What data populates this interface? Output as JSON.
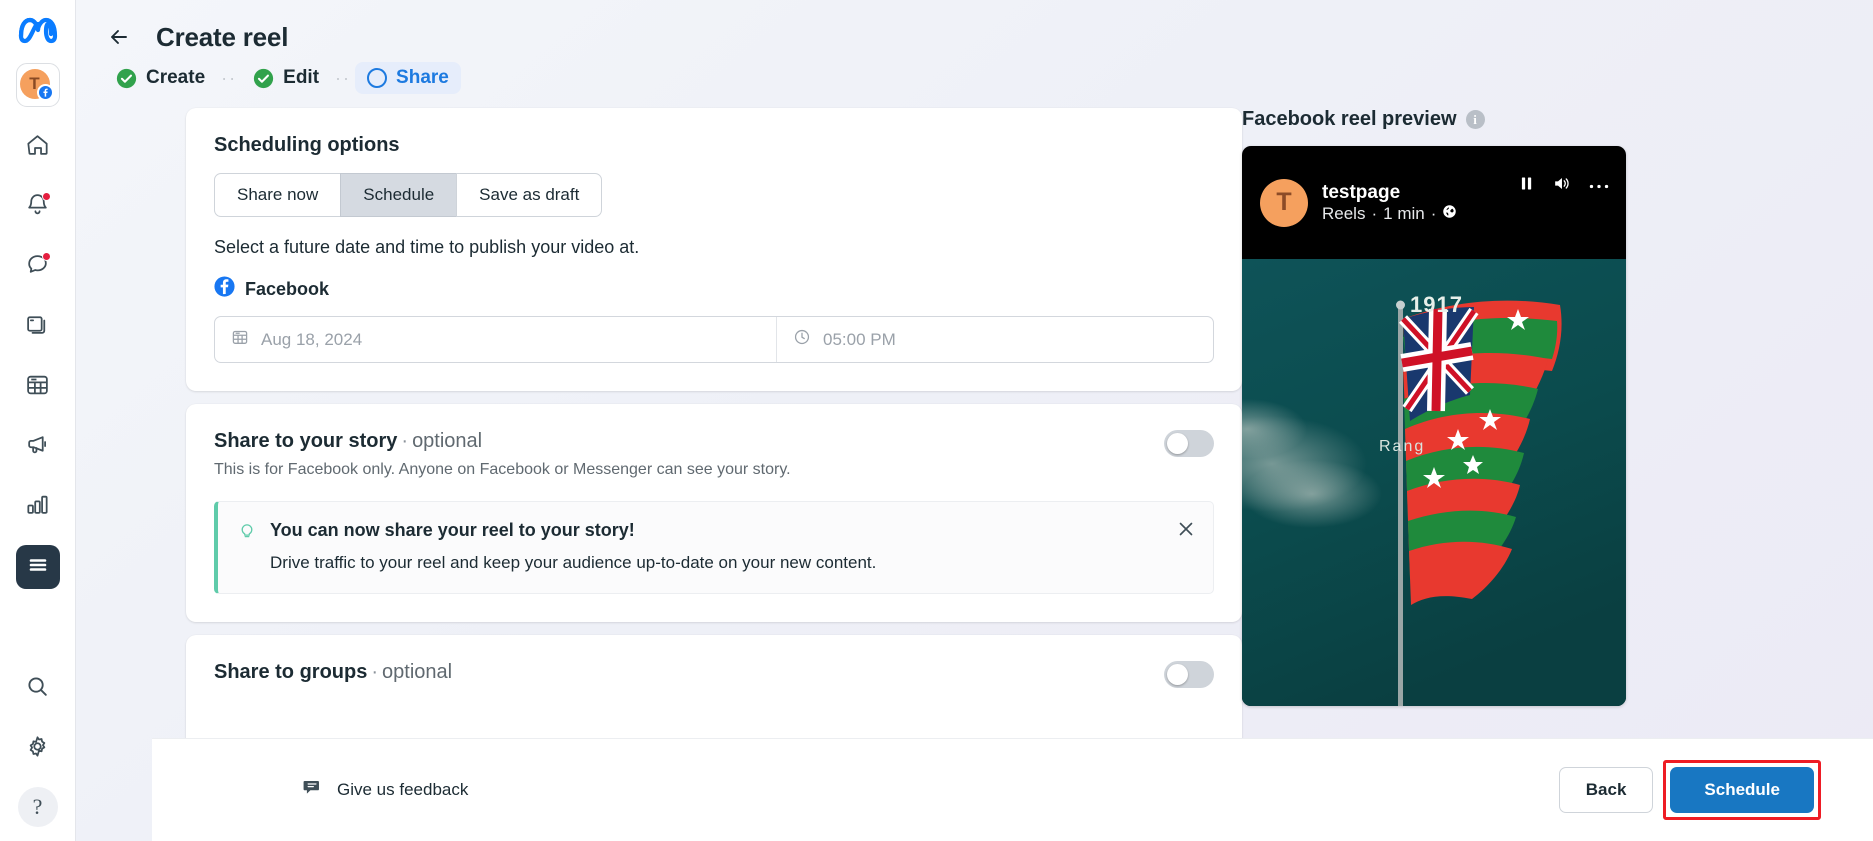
{
  "rail": {
    "logo": "meta-logo",
    "account": {
      "initial": "T",
      "badge": "facebook"
    },
    "items": [
      {
        "name": "home",
        "icon": "home-icon",
        "badge": false,
        "active": false
      },
      {
        "name": "notifications",
        "icon": "bell-icon",
        "badge": true,
        "active": false
      },
      {
        "name": "messages",
        "icon": "chat-bubble-icon",
        "badge": true,
        "active": false
      },
      {
        "name": "content",
        "icon": "content-pages-icon",
        "badge": false,
        "active": false
      },
      {
        "name": "planner",
        "icon": "calendar-icon",
        "badge": false,
        "active": false
      },
      {
        "name": "ads",
        "icon": "megaphone-icon",
        "badge": false,
        "active": false
      },
      {
        "name": "insights",
        "icon": "bar-chart-icon",
        "badge": false,
        "active": false
      },
      {
        "name": "all-tools",
        "icon": "hamburger-menu-icon",
        "badge": false,
        "active": true
      }
    ],
    "bottom": [
      {
        "name": "search",
        "icon": "search-icon"
      },
      {
        "name": "settings",
        "icon": "gear-icon"
      }
    ],
    "help_label": "?"
  },
  "header": {
    "back_label": "←",
    "title": "Create reel"
  },
  "stepper": {
    "dots": "··",
    "steps": [
      {
        "label": "Create",
        "state": "complete"
      },
      {
        "label": "Edit",
        "state": "complete"
      },
      {
        "label": "Share",
        "state": "current"
      }
    ]
  },
  "scheduling": {
    "heading": "Scheduling options",
    "options": [
      {
        "label": "Share now",
        "selected": false
      },
      {
        "label": "Schedule",
        "selected": true
      },
      {
        "label": "Save as draft",
        "selected": false
      }
    ],
    "helper": "Select a future date and time to publish your video at.",
    "platform": "Facebook",
    "date_value": "Aug 18, 2024",
    "time_value": "05:00 PM",
    "date_icon": "calendar-icon",
    "time_icon": "clock-icon"
  },
  "story": {
    "title": "Share to your story",
    "separator": "·",
    "optional": "optional",
    "subtitle": "This is for Facebook only. Anyone on Facebook or Messenger can see your story.",
    "toggle_on": false,
    "notice": {
      "icon": "lightbulb-icon",
      "title": "You can now share your reel to your story!",
      "body": "Drive traffic to your reel and keep your audience up-to-date on your new content.",
      "close_icon": "close-icon"
    }
  },
  "groups": {
    "title": "Share to groups",
    "separator": "·",
    "optional": "optional",
    "toggle_on": false
  },
  "preview": {
    "title": "Facebook reel preview",
    "info_icon": "info-icon",
    "info_glyph": "i",
    "page_name": "testpage",
    "page_initial": "T",
    "meta_type": "Reels",
    "meta_sep": "·",
    "meta_duration": "1 min",
    "meta_audience_icon": "globe-icon",
    "controls": [
      {
        "name": "pause-button",
        "icon": "pause-icon"
      },
      {
        "name": "volume-button",
        "icon": "speaker-icon"
      },
      {
        "name": "more-options-button",
        "icon": "ellipsis-icon"
      }
    ],
    "video": {
      "overlay_year": "1917",
      "overlay_caption": "Rang",
      "bg_color": "#0d5050"
    }
  },
  "footer": {
    "feedback_label": "Give us feedback",
    "feedback_icon": "feedback-icon",
    "back_label": "Back",
    "schedule_label": "Schedule",
    "highlight_color": "#ee1c25",
    "primary_color": "#1877c2"
  }
}
